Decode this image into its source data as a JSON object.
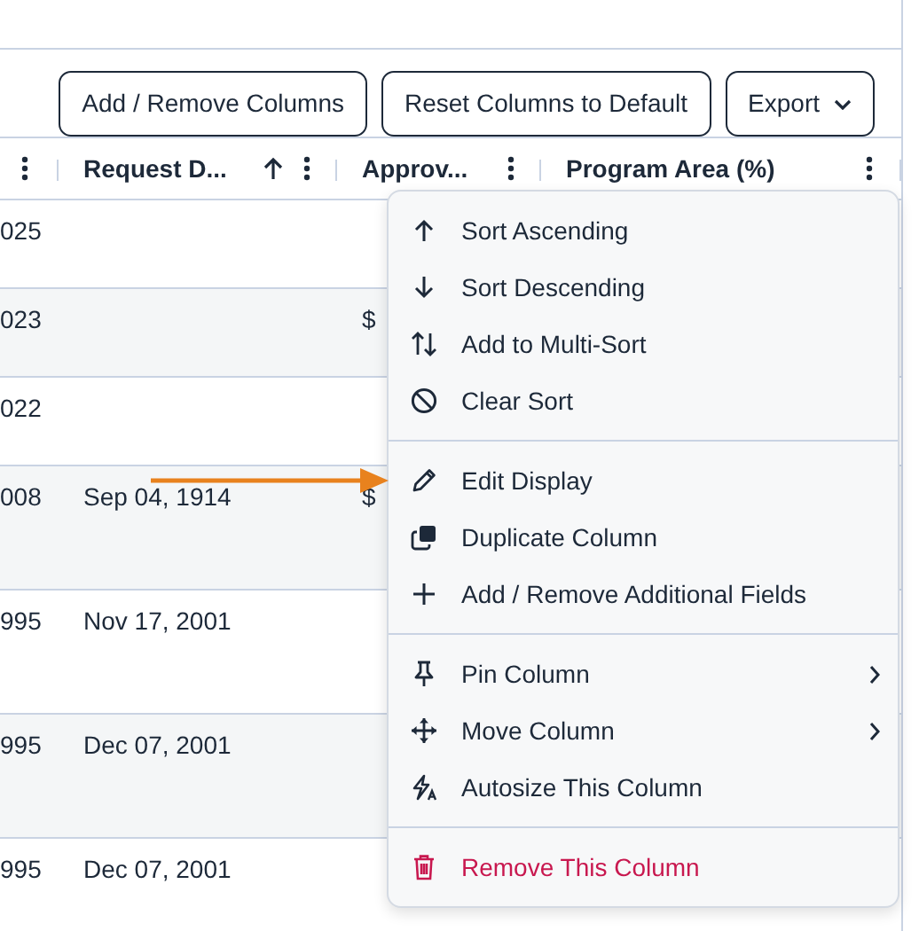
{
  "toolbar": {
    "buttons": [
      {
        "label": "Add / Remove Columns",
        "kind": "plain"
      },
      {
        "label": "Reset Columns to Default",
        "kind": "plain"
      },
      {
        "label": "Export",
        "kind": "dropdown"
      }
    ]
  },
  "table": {
    "columns": [
      {
        "sorted_ascending": false
      },
      {
        "label": "Request D...",
        "sorted_ascending": true
      },
      {
        "label": "Approv...",
        "sorted_ascending": false
      },
      {
        "label": "Program Area (%)",
        "sorted_ascending": false
      }
    ],
    "rows": [
      {
        "column_1": "025"
      },
      {
        "column_1": "023",
        "approved": "$"
      },
      {
        "column_1": "022"
      },
      {
        "column_1": "008",
        "request_date": "Sep 04, 1914",
        "approved": "$"
      },
      {
        "column_1": "995",
        "request_date": "Nov 17, 2001"
      },
      {
        "column_1": "995",
        "request_date": "Dec 07, 2001"
      },
      {
        "column_1": "995",
        "request_date": "Dec 07, 2001"
      }
    ]
  },
  "column_menu": {
    "groups": [
      [
        {
          "label": "Sort Ascending",
          "submenu": false,
          "danger": false
        },
        {
          "label": "Sort Descending",
          "submenu": false,
          "danger": false
        },
        {
          "label": "Add to Multi-Sort",
          "submenu": false,
          "danger": false
        },
        {
          "label": "Clear Sort",
          "submenu": false,
          "danger": false
        }
      ],
      [
        {
          "label": "Edit Display",
          "submenu": false,
          "danger": false
        },
        {
          "label": "Duplicate Column",
          "submenu": false,
          "danger": false
        },
        {
          "label": "Add / Remove Additional Fields",
          "submenu": false,
          "danger": false
        }
      ],
      [
        {
          "label": "Pin Column",
          "submenu": true,
          "danger": false
        },
        {
          "label": "Move Column",
          "submenu": true,
          "danger": false
        },
        {
          "label": "Autosize This Column",
          "submenu": false,
          "danger": false
        }
      ],
      [
        {
          "label": "Remove This Column",
          "submenu": false,
          "danger": true
        }
      ]
    ]
  }
}
